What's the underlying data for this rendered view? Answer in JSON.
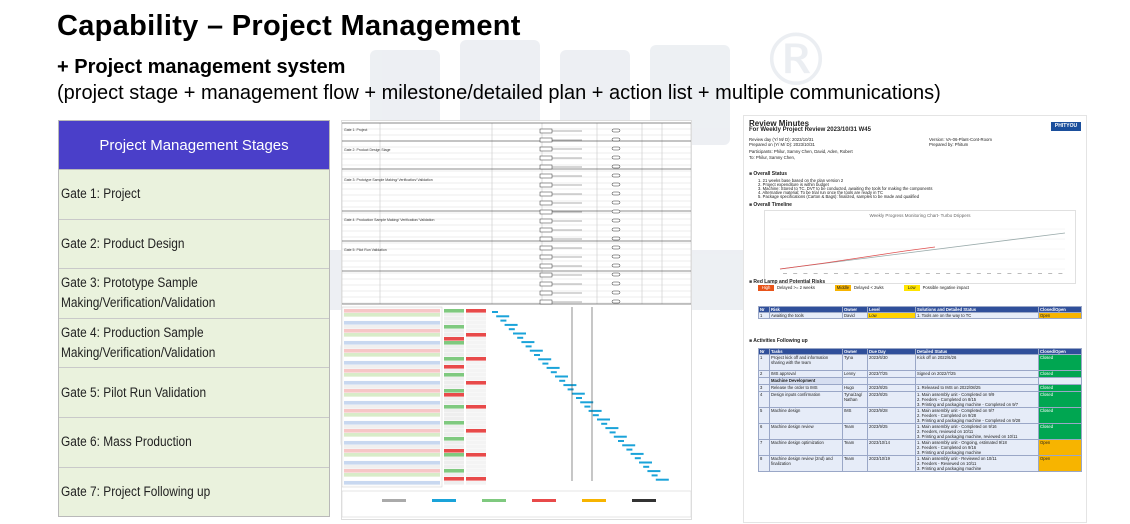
{
  "title": "Capability – Project Management",
  "subtitle": "+ Project management system",
  "description": "(project stage + management flow + milestone/detailed plan + action list + multiple communications)",
  "watermark": {
    "text": "®",
    "color": "#d9dde6"
  },
  "stages_table": {
    "header": "Project Management Stages",
    "header_color": "#4a3fc9",
    "row_color": "#eaf2dd",
    "rows": [
      "Gate 1: Project",
      "Gate 2: Product Design",
      "Gate 3: Prototype Sample Making/Verification/Validation",
      "Gate 4: Production Sample Making/Verification/Validation",
      "Gate 5: Pilot Run Validation",
      "Gate 6: Mass Production",
      "Gate 7: Project Following up"
    ]
  },
  "review_minutes": {
    "title": "Review Minutes",
    "subtitle": "For Weekly Project Review 2023/10/31  W45",
    "logo": "PHITYOU",
    "meta_left": [
      "Review day (Y/ M/ D): 2023/10/31",
      "Prepared on (Y/ M/ D): 2023/10/31"
    ],
    "meta_right": [
      "Version: VA-06-Plant-Cont-Room",
      "Prepared by: Phitum"
    ],
    "participants": "Participants: Philur, Samny Chen, David, Aden, Robert",
    "to": "To: Philur, Samny Chen,",
    "sections": {
      "overall_status": "Overall Status",
      "overall_timeline": "Overall Timeline",
      "risks": "Red Lamp and Potential Risks",
      "activities": "Activities Following up"
    },
    "status_lines": [
      "1. 21 weeks base based on the plan version 2",
      "2. Project expenditure is within budget",
      "3. Machine: Stored to TC. DVT to be conducted, awaiting the tools for making the components",
      "4. Alternative material: To be trial run once the tools are ready in TC",
      "5. Package specifications (Carton & Bags): finalized, samples to be made and qualified"
    ],
    "chart_title": "Weekly Progress Monitoring Chart- Turbo Drippers",
    "legend": [
      "High",
      "Delayed >= 2 weeks",
      "Middle",
      "Delayed < 2wks",
      "Low",
      "Possible negative impact"
    ],
    "risk_header": [
      "Nr",
      "Risk",
      "Owner",
      "Level",
      "Solutions and Detailed Status",
      "Closed/Open"
    ],
    "risk_rows": [
      [
        "1",
        "Awaiting the tools",
        "David",
        "Low",
        "1. Tools are on the way to TC",
        "Open"
      ]
    ],
    "act_header": [
      "Nr",
      "Tasks",
      "Owner",
      "Due Day",
      "Detailed Status",
      "Closed/Open"
    ],
    "act_rows": [
      [
        "1",
        "Project kick off and information sharing with the team",
        "Tyna",
        "2023/6/30",
        "Kick off on 2022/6/26",
        "Closed"
      ],
      [
        "2",
        "IMS approval",
        "Lenny",
        "2023/7/25",
        "Signed on 2022/7/25",
        "Closed"
      ],
      [
        "",
        "Machine Development",
        "",
        "",
        "",
        ""
      ],
      [
        "3",
        "Release the order to IMS",
        "Hugo",
        "2023/8/25",
        "1. Released to IMS on 2022/08/25",
        "Closed"
      ],
      [
        "4",
        "Design inputs confirmation",
        "Tyna/Jag/ Nathan",
        "2023/8/25",
        "1. Main assembly unit - Completed on 9/9\n2. Feeders - Completed on 8/15\n3. Printing and packaging machine - Completed on 9/7",
        "Closed"
      ],
      [
        "5",
        "Machine design",
        "IMS",
        "2023/9/28",
        "1. Main assembly unit - Completed on 9/7\n2. Feeders - Completed on 9/28\n3. Printing and packaging machine - Completed on 9/28",
        "Closed"
      ],
      [
        "6",
        "Machine design review",
        "Team",
        "2023/9/25",
        "1. Main assembly unit - Completed on 9/16\n2. Feeders, reviewed on 10/11\n3. Printing and packaging machine, reviewed on 10/11",
        "Closed"
      ],
      [
        "7",
        "Machine design optimization",
        "Team",
        "2023/10/14",
        "1. Main assembly unit - Ongoing, estimated 9/18\n2. Feeders - Completed on 9/16\n3. Printing and packaging machine",
        "Open"
      ],
      [
        "8",
        "Machine design review (2nd) and finalization",
        "Team",
        "2023/10/19",
        "1. Main assembly unit - Reviewed on 10/11\n2. Feeders - Reviewed on 10/11\n3. Printing and packaging machine",
        "Open"
      ]
    ]
  },
  "middle_doc": {
    "flow_rows": [
      "Gate 1: Project",
      "Gate 2: Product Design Stage",
      "Gate 3: Prototype Sample Making/ Verification/ Validation",
      "Gate 4: Production Sample Making/ Verification/ Validation",
      "Gate 5: Pilot Run Validation"
    ]
  }
}
